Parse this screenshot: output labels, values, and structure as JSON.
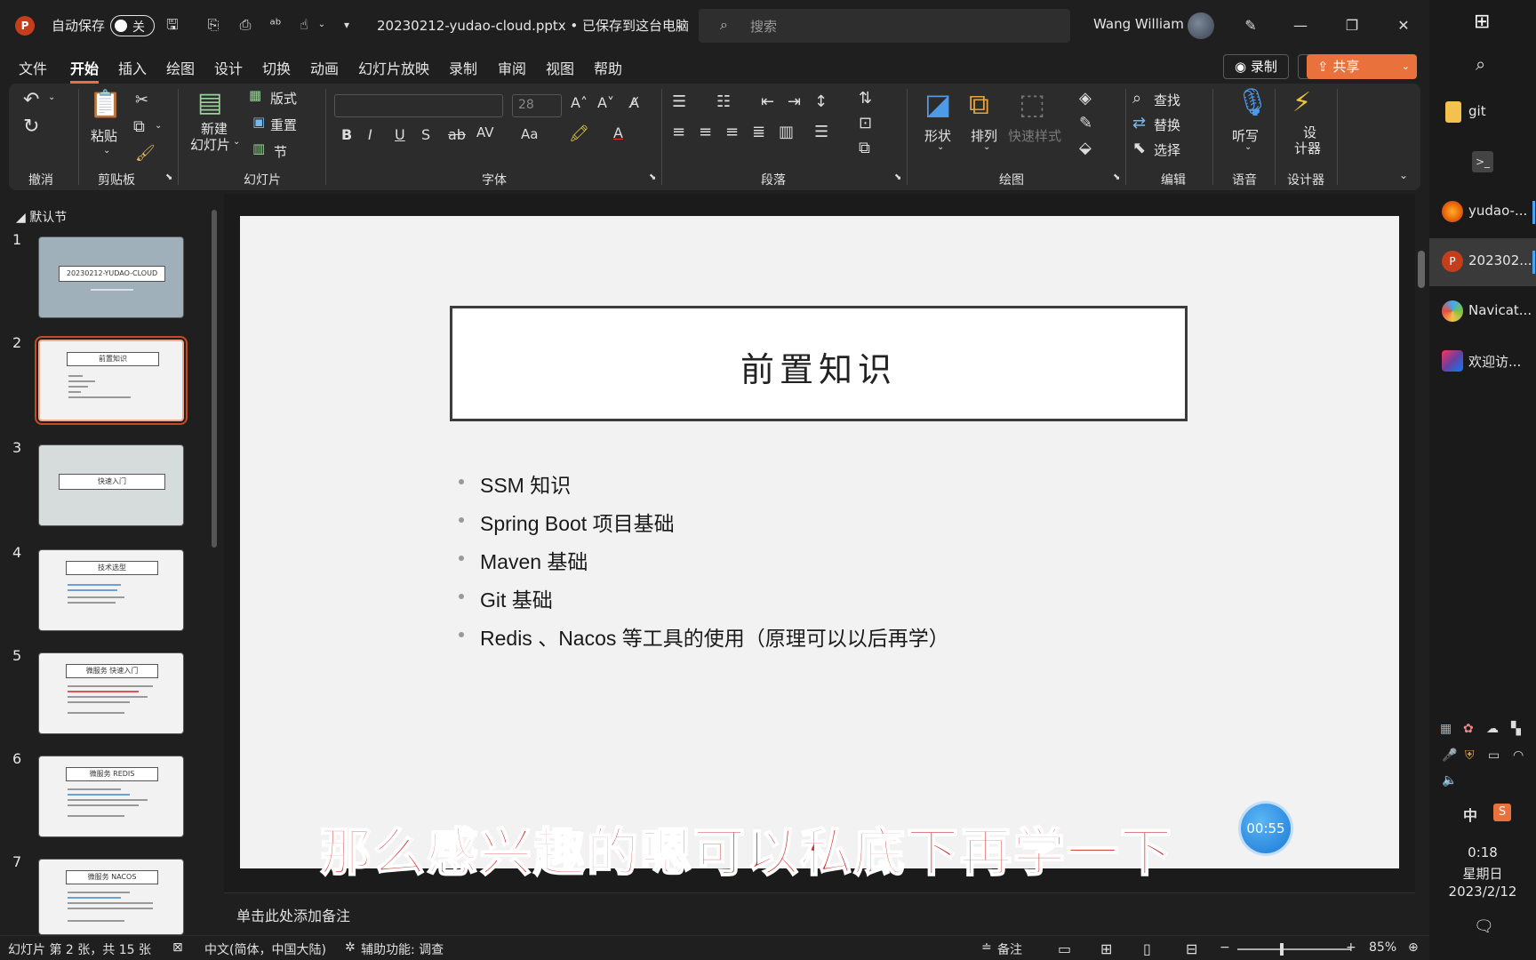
{
  "titlebar": {
    "app_logo": "P",
    "autosave_label": "自动保存",
    "autosave_state": "关",
    "filename": "20230212-yudao-cloud.pptx • 已保存到这台电脑",
    "search_placeholder": "搜索",
    "user_name": "Wang William"
  },
  "menu": {
    "items": [
      "文件",
      "开始",
      "插入",
      "绘图",
      "设计",
      "切换",
      "动画",
      "幻灯片放映",
      "录制",
      "审阅",
      "视图",
      "帮助"
    ],
    "active": "开始",
    "record_label": "录制",
    "share_label": "共享"
  },
  "ribbon": {
    "groups": [
      "撤消",
      "剪贴板",
      "幻灯片",
      "字体",
      "段落",
      "绘图",
      "编辑",
      "语音",
      "设计器"
    ],
    "paste_label": "粘贴",
    "new_slide_label": "新建\n幻灯片",
    "new_slide_line1": "新建",
    "new_slide_line2": "幻灯片",
    "layout_label": "版式",
    "reset_label": "重置",
    "section_label": "节",
    "font_size": "28",
    "shape_label": "形状",
    "arrange_label": "排列",
    "quick_style_label": "快速样式",
    "find_label": "查找",
    "replace_label": "替换",
    "select_label": "选择",
    "dictate_label": "听写",
    "designer_line1": "设",
    "designer_line2": "计器"
  },
  "thumbnails": {
    "section_name": "默认节",
    "selected": 2,
    "slides": [
      {
        "num": "1",
        "title": "20230212-YUDAO-CLOUD",
        "bg": "#9fb0bb"
      },
      {
        "num": "2",
        "title": "前置知识",
        "bg": "#f2f2f2"
      },
      {
        "num": "3",
        "title": "快速入门",
        "bg": "#d6dcdc"
      },
      {
        "num": "4",
        "title": "技术选型",
        "bg": "#f2f2f2"
      },
      {
        "num": "5",
        "title": "微服务 快速入门",
        "bg": "#f2f2f2"
      },
      {
        "num": "6",
        "title": "微服务 REDIS",
        "bg": "#f2f2f2"
      },
      {
        "num": "7",
        "title": "微服务 NACOS",
        "bg": "#f2f2f2"
      }
    ]
  },
  "slide": {
    "title": "前置知识",
    "bullets": [
      "SSM 知识",
      "Spring Boot 项目基础",
      "Maven 基础",
      "Git 基础",
      "Redis 、Nacos 等工具的使用（原理可以以后再学）"
    ]
  },
  "overlay": {
    "subtitle": "那么感兴趣的嗯可以私底下再学一下",
    "timer": "00:55"
  },
  "notes": {
    "placeholder": "单击此处添加备注"
  },
  "statusbar": {
    "slide_info": "幻灯片 第 2 张，共 15 张",
    "language": "中文(简体，中国大陆)",
    "accessibility": "辅助功能: 调查",
    "notes_label": "备注",
    "zoom": "85%"
  },
  "taskbar": {
    "items": [
      {
        "label": "git",
        "color": "#f2c14e"
      },
      {
        "label": "",
        "color": "#444"
      },
      {
        "label": "yudao-...",
        "color": "#e66000"
      },
      {
        "label": "202302...",
        "color": "#c43e1c"
      },
      {
        "label": "Navicat...",
        "color": "#3fa9f5"
      },
      {
        "label": "欢迎访...",
        "color": "#6b3fa0"
      }
    ],
    "ime_mode": "中",
    "time": "0:18",
    "weekday": "星期日",
    "date": "2023/2/12"
  }
}
